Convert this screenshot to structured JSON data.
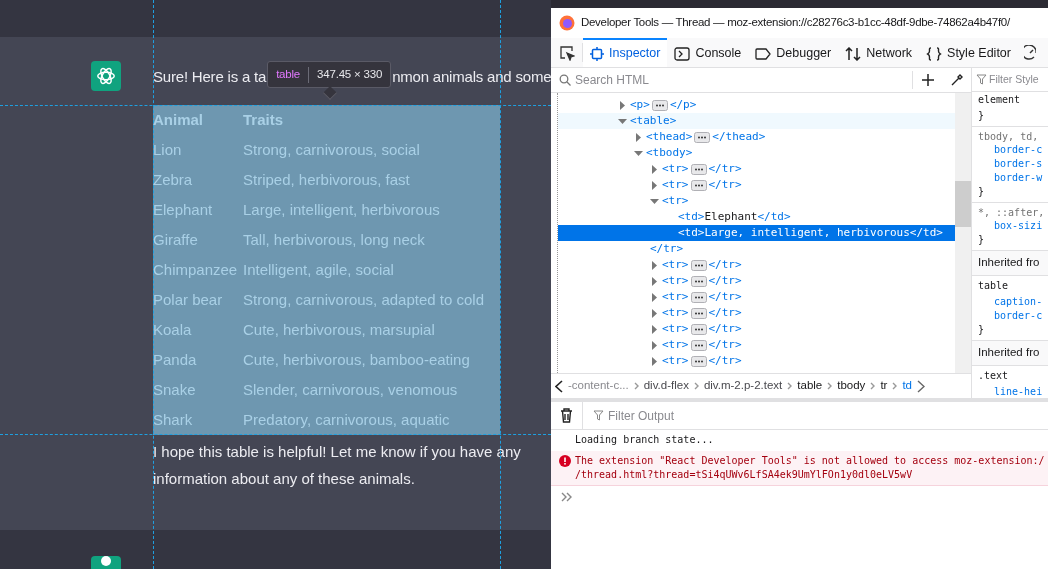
{
  "chat": {
    "intro_parts": [
      "Sure! Here is a ta",
      "nmon animals and some"
    ],
    "tooltip": {
      "tag": "table",
      "size": "347.45 × 330"
    },
    "table": {
      "columns": [
        "Animal",
        "Traits"
      ],
      "rows": [
        [
          "Lion",
          "Strong, carnivorous, social"
        ],
        [
          "Zebra",
          "Striped, herbivorous, fast"
        ],
        [
          "Elephant",
          "Large, intelligent, herbivorous"
        ],
        [
          "Giraffe",
          "Tall, herbivorous, long neck"
        ],
        [
          "Chimpanzee",
          "Intelligent, agile, social"
        ],
        [
          "Polar bear",
          "Strong, carnivorous, adapted to cold"
        ],
        [
          "Koala",
          "Cute, herbivorous, marsupial"
        ],
        [
          "Panda",
          "Cute, herbivorous, bamboo-eating"
        ],
        [
          "Snake",
          "Slender, carnivorous, venomous"
        ],
        [
          "Shark",
          "Predatory, carnivorous, aquatic"
        ]
      ]
    },
    "outro_lines": [
      "I hope this table is helpful! Let me know if you have any",
      "information about any of these animals."
    ]
  },
  "devtools": {
    "title": "Developer Tools — Thread — moz-extension://c28276c3-b1cc-48df-9dbe-74862a4b47f0/",
    "tabs": [
      {
        "label": "Inspector",
        "kind": "inspector",
        "selected": true
      },
      {
        "label": "Console",
        "kind": "console",
        "selected": false
      },
      {
        "label": "Debugger",
        "kind": "debugger",
        "selected": false
      },
      {
        "label": "Network",
        "kind": "network",
        "selected": false
      },
      {
        "label": "Style Editor",
        "kind": "style",
        "selected": false
      }
    ],
    "search": {
      "placeholder": "Search HTML"
    },
    "tree": [
      {
        "open": "<p>",
        "close": "</p>",
        "expanded": false,
        "selected": false,
        "hovered": false
      },
      {
        "open": "<table>",
        "expanded": true,
        "selected": false,
        "hovered": true,
        "children": [
          {
            "open": "<thead>",
            "close": "</thead>",
            "expanded": false,
            "selected": false,
            "hovered": false
          },
          {
            "open": "<tbody>",
            "expanded": true,
            "selected": false,
            "hovered": false,
            "children": [
              {
                "open": "<tr>",
                "close": "</tr>",
                "expanded": false,
                "selected": false,
                "hovered": false
              },
              {
                "open": "<tr>",
                "close": "</tr>",
                "expanded": false,
                "selected": false,
                "hovered": false
              },
              {
                "open": "<tr>",
                "close": "</tr>",
                "expanded": true,
                "selected": false,
                "hovered": false,
                "children": [
                  {
                    "open": "<td>",
                    "text": "Elephant",
                    "close": "</td>",
                    "selected": false,
                    "hovered": false
                  },
                  {
                    "open": "<td>",
                    "text": "Large, intelligent, herbivorous",
                    "close": "</td>",
                    "selected": true,
                    "hovered": false
                  }
                ]
              },
              {
                "open": "<tr>",
                "close": "</tr>",
                "expanded": false,
                "selected": false,
                "hovered": false
              },
              {
                "open": "<tr>",
                "close": "</tr>",
                "expanded": false,
                "selected": false,
                "hovered": false
              },
              {
                "open": "<tr>",
                "close": "</tr>",
                "expanded": false,
                "selected": false,
                "hovered": false
              },
              {
                "open": "<tr>",
                "close": "</tr>",
                "expanded": false,
                "selected": false,
                "hovered": false
              },
              {
                "open": "<tr>",
                "close": "</tr>",
                "expanded": false,
                "selected": false,
                "hovered": false
              },
              {
                "open": "<tr>",
                "close": "</tr>",
                "expanded": false,
                "selected": false,
                "hovered": false
              },
              {
                "open": "<tr>",
                "close": "</tr>",
                "expanded": false,
                "selected": false,
                "hovered": false
              }
            ]
          }
        ]
      }
    ],
    "breadcrumbs": [
      {
        "label": "-content-c...",
        "selected": false
      },
      {
        "label": "div.d-flex",
        "selected": false
      },
      {
        "label": "div.m-2.p-2.text",
        "selected": false
      },
      {
        "label": "table",
        "selected": false
      },
      {
        "label": "tbody",
        "selected": false
      },
      {
        "label": "tr",
        "selected": false
      },
      {
        "label": "td",
        "selected": true
      }
    ],
    "rules": {
      "filter_placeholder": "Filter Style",
      "lines": [
        {
          "kind": "selector",
          "text": "element"
        },
        {
          "kind": "brace",
          "text": "}"
        },
        {
          "kind": "selector-dim",
          "text": "tbody, td,"
        },
        {
          "kind": "prop",
          "text": "border-c"
        },
        {
          "kind": "prop",
          "text": "border-s"
        },
        {
          "kind": "prop",
          "text": "border-w"
        },
        {
          "kind": "brace",
          "text": "}"
        },
        {
          "kind": "selector-dim",
          "text": "*, ::after,"
        },
        {
          "kind": "prop",
          "text": "box-sizi"
        },
        {
          "kind": "brace",
          "text": "}"
        },
        {
          "kind": "header",
          "text": "Inherited fro"
        },
        {
          "kind": "selector",
          "text": "table"
        },
        {
          "kind": "prop",
          "text": "caption-"
        },
        {
          "kind": "prop",
          "text": "border-c"
        },
        {
          "kind": "brace",
          "text": "}"
        },
        {
          "kind": "header",
          "text": "Inherited fro"
        },
        {
          "kind": "selector",
          "text": ".text"
        },
        {
          "kind": "prop",
          "text": "line-hei"
        }
      ]
    },
    "console": {
      "filter_placeholder": "Filter Output",
      "messages": [
        {
          "kind": "log",
          "lines": [
            "Loading branch state..."
          ]
        },
        {
          "kind": "error",
          "lines": [
            "The extension \"React Developer Tools\" is not allowed to access moz-extension:/",
            "/thread.html?thread=tSi4qUWv6LfSA4ek9UmYlFOn1y0dl0eLV5wV"
          ]
        }
      ]
    }
  }
}
